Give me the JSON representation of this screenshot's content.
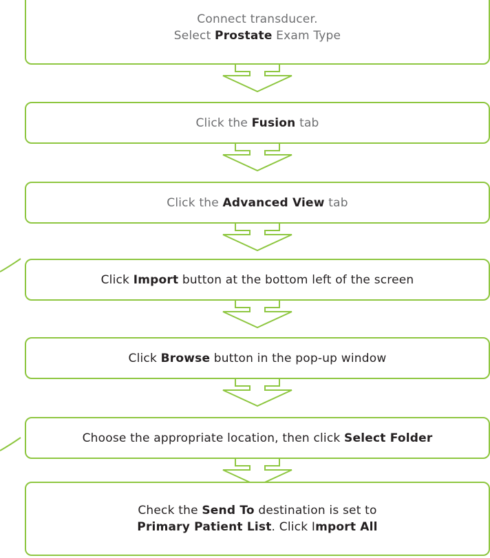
{
  "colors": {
    "accent": "#8dc63f",
    "text_dark": "#231f20",
    "text_grey": "#6d6e70"
  },
  "steps": [
    {
      "style": "faded",
      "lines": [
        [
          {
            "t": "Connect transducer.",
            "b": false
          }
        ],
        [
          {
            "t": "Select ",
            "b": false
          },
          {
            "t": "Prostate",
            "b": true
          },
          {
            "t": " Exam Type",
            "b": false
          }
        ]
      ]
    },
    {
      "style": "faded",
      "lines": [
        [
          {
            "t": "Click the ",
            "b": false
          },
          {
            "t": "Fusion",
            "b": true
          },
          {
            "t": " tab",
            "b": false
          }
        ]
      ]
    },
    {
      "style": "faded",
      "lines": [
        [
          {
            "t": "Click the ",
            "b": false
          },
          {
            "t": "Advanced View",
            "b": true
          },
          {
            "t": " tab",
            "b": false
          }
        ]
      ]
    },
    {
      "style": "dark",
      "lines": [
        [
          {
            "t": "Click ",
            "b": false
          },
          {
            "t": "Import",
            "b": true
          },
          {
            "t": " button at the bottom left of the screen",
            "b": false
          }
        ]
      ]
    },
    {
      "style": "dark",
      "lines": [
        [
          {
            "t": "Click ",
            "b": false
          },
          {
            "t": "Browse",
            "b": true
          },
          {
            "t": " button in the pop-up window",
            "b": false
          }
        ]
      ]
    },
    {
      "style": "dark",
      "lines": [
        [
          {
            "t": "Choose the appropriate location, then click ",
            "b": false
          },
          {
            "t": "Select Folder",
            "b": true
          }
        ]
      ]
    },
    {
      "style": "dark",
      "lines": [
        [
          {
            "t": "Check the ",
            "b": false
          },
          {
            "t": "Send To",
            "b": true
          },
          {
            "t": " destination is set to",
            "b": false
          }
        ],
        [
          {
            "t": "Primary Patient List",
            "b": true
          },
          {
            "t": ". Click I",
            "b": false
          },
          {
            "t": "mport All",
            "b": true
          }
        ]
      ]
    }
  ]
}
